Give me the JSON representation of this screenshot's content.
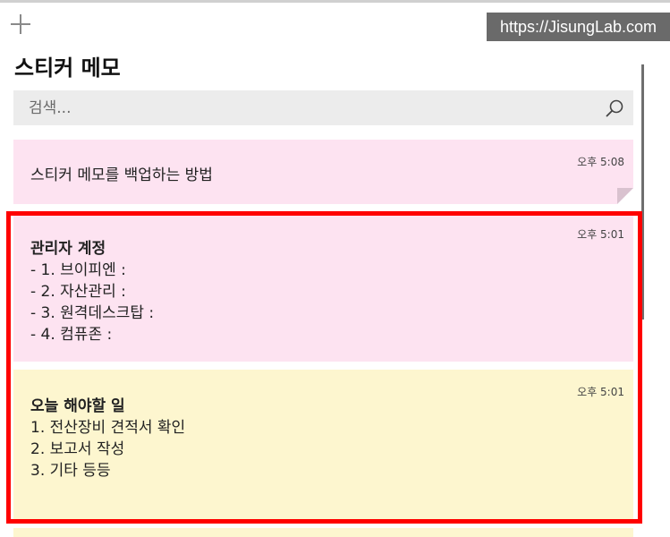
{
  "app": {
    "title": "스티커 메모"
  },
  "watermark": "https://JisungLab.com",
  "search": {
    "placeholder": "검색..."
  },
  "notes": [
    {
      "time": "오후 5:08",
      "lines": [
        "스티커 메모를 백업하는 방법"
      ]
    },
    {
      "time": "오후 5:01",
      "heading": "관리자 계정",
      "lines": [
        "- 1. 브이피엔 :",
        "- 2. 자산관리 :",
        "- 3. 원격데스크탑 :",
        "- 4. 컴퓨존 :"
      ]
    },
    {
      "time": "오후 5:01",
      "heading": "오늘 해야할 일",
      "lines": [
        "1. 전산장비 견적서 확인",
        "2. 보고서 작성",
        "3. 기타 등등"
      ]
    }
  ],
  "colors": {
    "note_pink": "#fde3f1",
    "note_yellow": "#fdf6cf",
    "highlight": "#ff0000",
    "search_bg": "#ececec"
  },
  "icons": {
    "add": "plus-icon",
    "search": "search-icon"
  }
}
